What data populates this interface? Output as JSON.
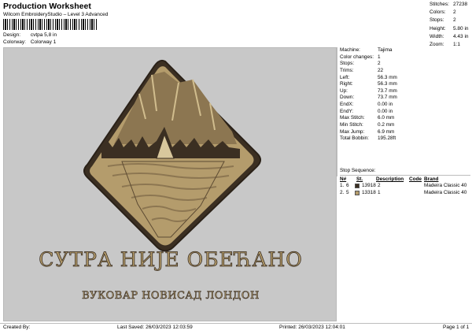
{
  "header": {
    "title": "Production Worksheet",
    "subtitle": "Wilcom EmbroideryStudio – Level 3 Advanced",
    "design_label": "Design:",
    "design_value": "cvtpa 5,8 in",
    "colorway_label": "Colorway:",
    "colorway_value": "Colorway 1"
  },
  "stats": [
    {
      "label": "Stitches:",
      "value": "27238"
    },
    {
      "label": "Colors:",
      "value": "2"
    },
    {
      "label": "Stops:",
      "value": "2"
    },
    {
      "label": "Height:",
      "value": "5.80 in"
    },
    {
      "label": "Width:",
      "value": "4.43 in"
    },
    {
      "label": "Zoom:",
      "value": "1:1"
    }
  ],
  "design_text": {
    "line1": "СУТРА НИЈЕ ОБЕЋАНО",
    "line2": "ВУКОВАР НОВИСАД ЛОНДОН"
  },
  "machine": [
    {
      "label": "Machine:",
      "value": "Tajima"
    },
    {
      "label": "Color changes:",
      "value": "1"
    },
    {
      "label": "Stops:",
      "value": "2"
    },
    {
      "label": "Trims:",
      "value": "22"
    },
    {
      "label": "Left:",
      "value": "56.3 mm"
    },
    {
      "label": "Right:",
      "value": "56.3 mm"
    },
    {
      "label": "Up:",
      "value": "73.7 mm"
    },
    {
      "label": "Down:",
      "value": "73.7 mm"
    },
    {
      "label": "EndX:",
      "value": "0.00 in"
    },
    {
      "label": "EndY:",
      "value": "0.00 in"
    },
    {
      "label": "Max Stitch:",
      "value": "6.0 mm"
    },
    {
      "label": "Min Stitch:",
      "value": "0.2 mm"
    },
    {
      "label": "Max Jump:",
      "value": "6.9 mm"
    },
    {
      "label": "Total Bobbin:",
      "value": "195.28ft"
    }
  ],
  "sequence": {
    "title": "Stop Sequence:",
    "headers": {
      "n": "N#",
      "st": "St.",
      "description": "Description",
      "code": "Code",
      "brand": "Brand"
    },
    "rows": [
      {
        "idx": "1.",
        "n": "6",
        "color": "#3b2f22",
        "st": "13918",
        "description": "2",
        "code": "",
        "brand": "Madeira Classic 40"
      },
      {
        "idx": "2.",
        "n": "5",
        "color": "#b49c6c",
        "st": "13318",
        "description": "1",
        "code": "",
        "brand": "Madeira Classic 40"
      }
    ]
  },
  "footer": {
    "created": "Created By:",
    "saved": "Last Saved: 26/03/2023 12:03:59",
    "printed": "Printed: 26/03/2023 12:04:01",
    "page": "Page 1 of 1"
  },
  "colors": {
    "canvas": "#c8c8c8",
    "thread_dark": "#3b2f22",
    "thread_light": "#b49c6c"
  }
}
